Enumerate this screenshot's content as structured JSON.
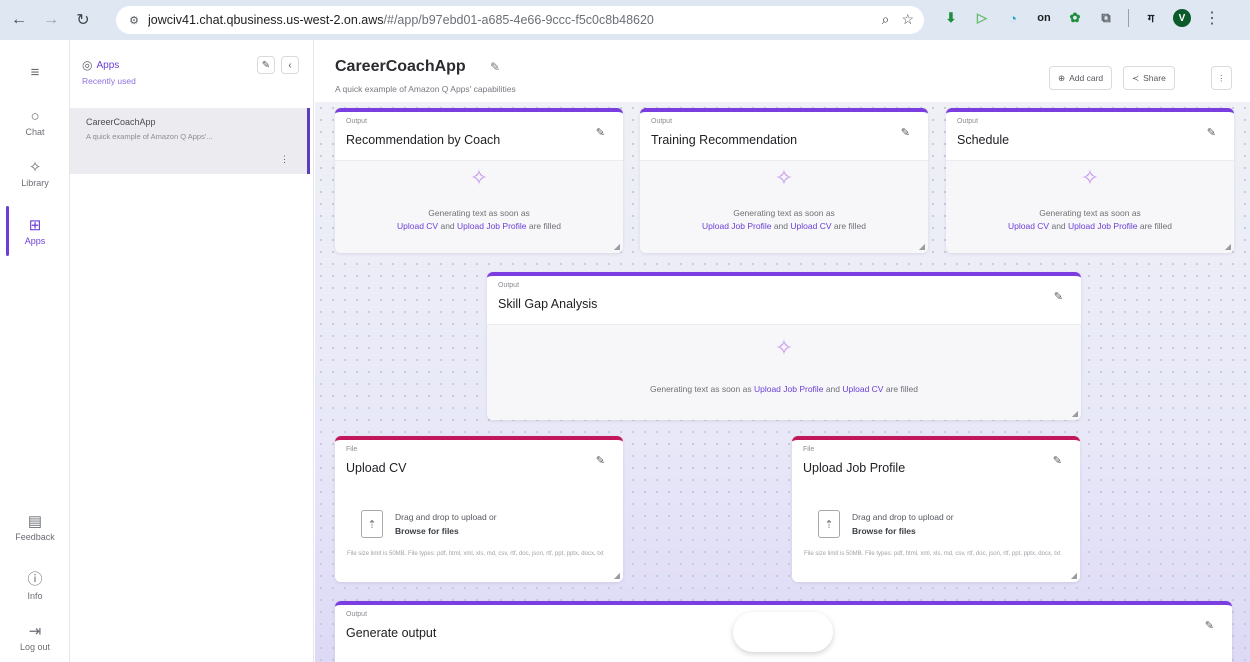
{
  "browser": {
    "url_host": "jowciv41.chat.qbusiness.us-west-2.on.aws",
    "url_path": "/#/app/b97ebd01-a685-4e66-9ccc-f5c0c8b48620",
    "ext_dark_label": "on",
    "ext_profile_initials": "ग",
    "avatar_initial": "V"
  },
  "rail": {
    "chat": "Chat",
    "library": "Library",
    "apps": "Apps",
    "feedback": "Feedback",
    "info": "Info",
    "logout": "Log out"
  },
  "sidebar": {
    "title": "Apps",
    "subtitle": "Recently used",
    "item": {
      "title": "CareerCoachApp",
      "desc": "A quick example of Amazon Q Apps'..."
    }
  },
  "header": {
    "title": "CareerCoachApp",
    "subtitle": "A quick example of Amazon Q Apps' capabilities",
    "add_card": "Add card",
    "share": "Share"
  },
  "cards": {
    "coach": {
      "type": "Output",
      "title": "Recommendation by Coach",
      "gen_prefix": "Generating text as soon as",
      "link1": "Upload CV",
      "joiner": "and",
      "link2": "Upload Job Profile",
      "suffix": "are filled"
    },
    "training": {
      "type": "Output",
      "title": "Training Recommendation",
      "gen_prefix": "Generating text as soon as",
      "link1": "Upload Job Profile",
      "joiner": "and",
      "link2": "Upload CV",
      "suffix": "are filled"
    },
    "schedule": {
      "type": "Output",
      "title": "Schedule",
      "gen_prefix": "Generating text as soon as",
      "link1": "Upload CV",
      "joiner": "and",
      "link2": "Upload Job Profile",
      "suffix": "are filled"
    },
    "skillgap": {
      "type": "Output",
      "title": "Skill Gap Analysis",
      "gen_prefix": "Generating text as soon as",
      "link1": "Upload Job Profile",
      "joiner": "and",
      "link2": "Upload CV",
      "suffix": "are filled"
    },
    "upload_cv": {
      "type": "File",
      "title": "Upload CV",
      "dz1": "Drag and drop to upload or",
      "dz2": "Browse for files",
      "hint": "File size limit is 50MB. File types: pdf, html, xml, xls, md, csv, rtf, doc, json, rtf, ppt, pptx, docx, txt"
    },
    "upload_job": {
      "type": "File",
      "title": "Upload Job Profile",
      "dz1": "Drag and drop to upload or",
      "dz2": "Browse for files",
      "hint": "File size limit is 50MB. File types: pdf, html, xml, xls, md, csv, rtf, doc, json, rtf, ppt, pptx, docx, txt"
    },
    "generate": {
      "type": "Output",
      "title": "Generate output"
    }
  }
}
